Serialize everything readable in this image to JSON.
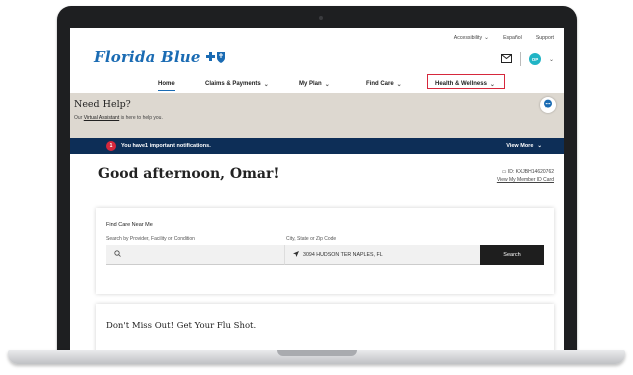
{
  "utility": {
    "accessibility": "Accessibility",
    "espanol": "Español",
    "support": "Support"
  },
  "brand": {
    "name": "Florida Blue"
  },
  "user": {
    "initials": "OP"
  },
  "nav": {
    "items": [
      {
        "label": "Home"
      },
      {
        "label": "Claims & Payments"
      },
      {
        "label": "My Plan"
      },
      {
        "label": "Find Care"
      },
      {
        "label": "Health & Wellness"
      }
    ]
  },
  "help": {
    "title": "Need Help?",
    "sub_prefix": "Our ",
    "sub_link": "Virtual Assistant",
    "sub_suffix": " is here to help you."
  },
  "notification": {
    "count": "1",
    "text": "You have1 important notifications.",
    "view_more": "View More"
  },
  "greeting": "Good afternoon, Omar!",
  "member": {
    "id": "ID: KXJBH14620762",
    "link": "View My Member ID Card"
  },
  "find_care": {
    "title": "Find Care Near Me",
    "search_label": "Search by Provider, Facility or Condition",
    "location_label": "City, State or Zip Code",
    "location_value": "3094 HUDSON TER NAPLES, FL",
    "search_button": "Search"
  },
  "promo": {
    "title": "Don't Miss Out! Get Your Flu Shot."
  },
  "colors": {
    "brand_blue": "#1a6bb3",
    "navy": "#0d2e57",
    "alert_red": "#d6283c"
  }
}
